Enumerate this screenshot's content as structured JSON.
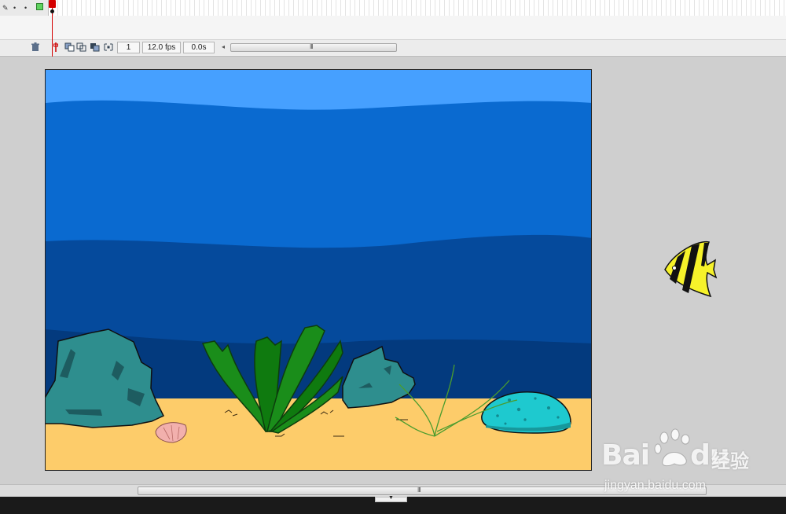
{
  "timeline": {
    "layer_controls": {
      "edit_icon": "pencil-icon",
      "visibility_dot": "•",
      "lock_dot": "•",
      "outline_color": "#5fd35f"
    },
    "current_frame": "1",
    "frame_rate": "12.0 fps",
    "elapsed_time": "0.0s",
    "scroll_grip": "III"
  },
  "stage": {
    "colors": {
      "sky_water": "#46a0ff",
      "upper_water": "#0a6ad0",
      "mid_water": "#054a9c",
      "deep_water": "#033a7e",
      "sand": "#fdcc6a",
      "rock": "#2e8e8e",
      "boulder": "#1ec9cf",
      "seaweed": "#1a8d1a"
    }
  },
  "offstage_fish": {
    "colors": {
      "body": "#f6f22a",
      "stripe": "#111111"
    }
  },
  "bottom_scroll": {
    "grip": "III"
  },
  "watermark": {
    "brand": "Bai",
    "brand_suffix": "du",
    "chinese": "经验",
    "url": "jingyan.baidu.com"
  }
}
